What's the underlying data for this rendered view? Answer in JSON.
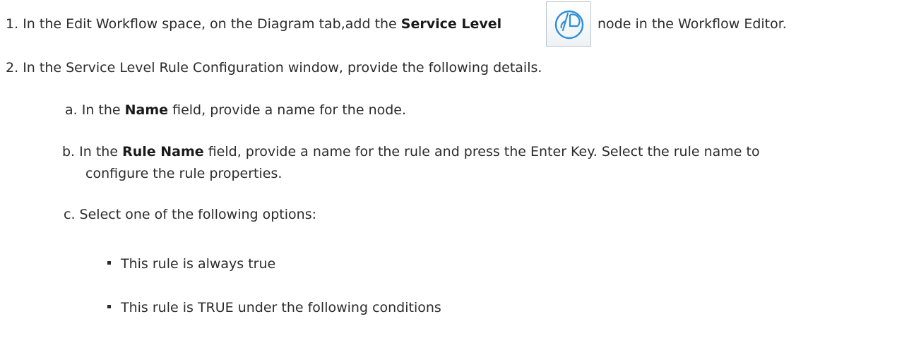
{
  "step1": {
    "number": "1.",
    "text_before": "In the Edit Workflow space, on the Diagram tab,add the",
    "bold": "Service Level",
    "text_after": "node in the Workflow Editor.",
    "icon": "service-level-node-icon"
  },
  "step2": {
    "number": "2.",
    "text": "In the Service Level Rule Configuration window, provide the following details."
  },
  "substeps": {
    "a": {
      "letter": "a.",
      "prefix": "In the",
      "bold": "Name",
      "suffix": "field, provide a name for the node."
    },
    "b": {
      "letter": "b.",
      "prefix": "In the",
      "bold": "Rule Name",
      "suffix": "field, provide a name for the rule and press the Enter Key. Select the rule name to",
      "continuation": "configure the rule properties."
    },
    "c": {
      "letter": "c.",
      "text": "Select one of the following options:"
    }
  },
  "options": [
    "This rule is always true",
    "This rule is TRUE under the following conditions"
  ],
  "colors": {
    "text": "#2b2b2b",
    "icon_stroke": "#2f8fd6",
    "icon_border": "#b9c3cc"
  }
}
